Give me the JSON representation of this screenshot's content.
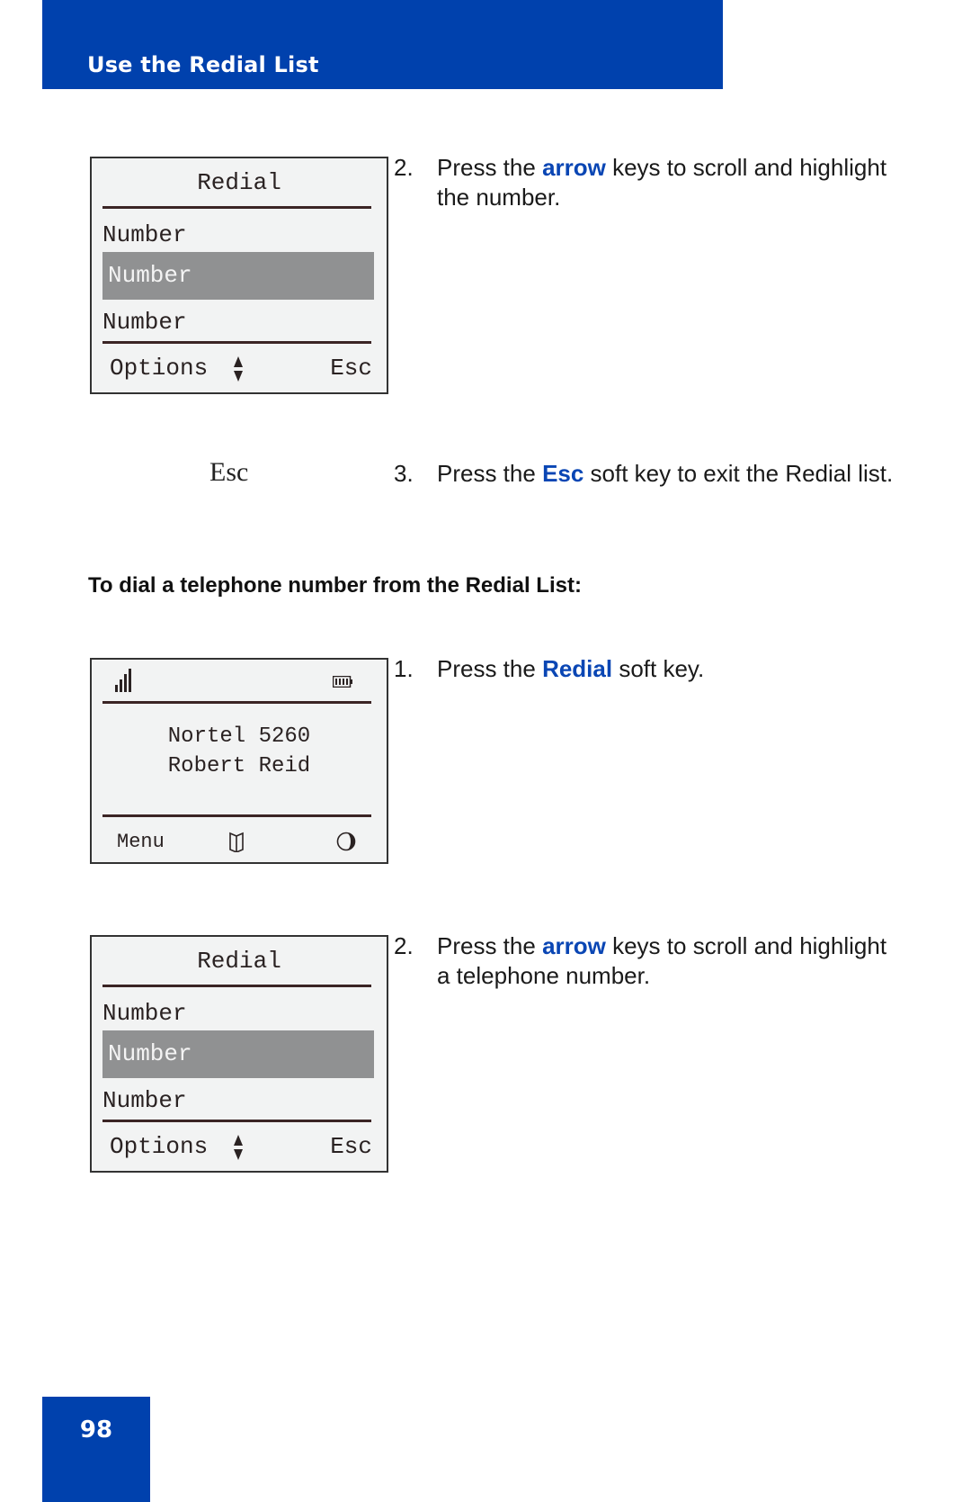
{
  "header": {
    "title": "Use the Redial List"
  },
  "screens": {
    "redial_list_1": {
      "title": "Redial",
      "rows": [
        "Number",
        "Number",
        "Number"
      ],
      "highlighted_row": 1,
      "softkeys": {
        "left": "Options",
        "right": "Esc"
      }
    },
    "idle": {
      "line1": "Nortel 5260",
      "line2": "Robert Reid",
      "softkeys": {
        "left": "Menu"
      }
    },
    "redial_list_2": {
      "title": "Redial",
      "rows": [
        "Number",
        "Number",
        "Number"
      ],
      "highlighted_row": 1,
      "softkeys": {
        "left": "Options",
        "right": "Esc"
      }
    }
  },
  "steps_exit": [
    {
      "num": "2.",
      "pre": "Press the ",
      "kw": "arrow",
      "post": " keys to scroll and highlight the number."
    },
    {
      "num": "3.",
      "pre": "Press the ",
      "kw": "Esc",
      "post": " soft key to exit the Redial list."
    }
  ],
  "esc_label": "Esc",
  "section_heading": "To dial a telephone number from the Redial List:",
  "steps_dial": [
    {
      "num": "1.",
      "pre": "Press the ",
      "kw": "Redial",
      "post": " soft key."
    },
    {
      "num": "2.",
      "pre": "Press the ",
      "kw": "arrow",
      "post": " keys to scroll and highlight a telephone number."
    }
  ],
  "page_number": "98",
  "colors": {
    "brand_blue": "#0041ad",
    "keyword_blue": "#0a46b4",
    "highlight_gray": "#909192"
  }
}
